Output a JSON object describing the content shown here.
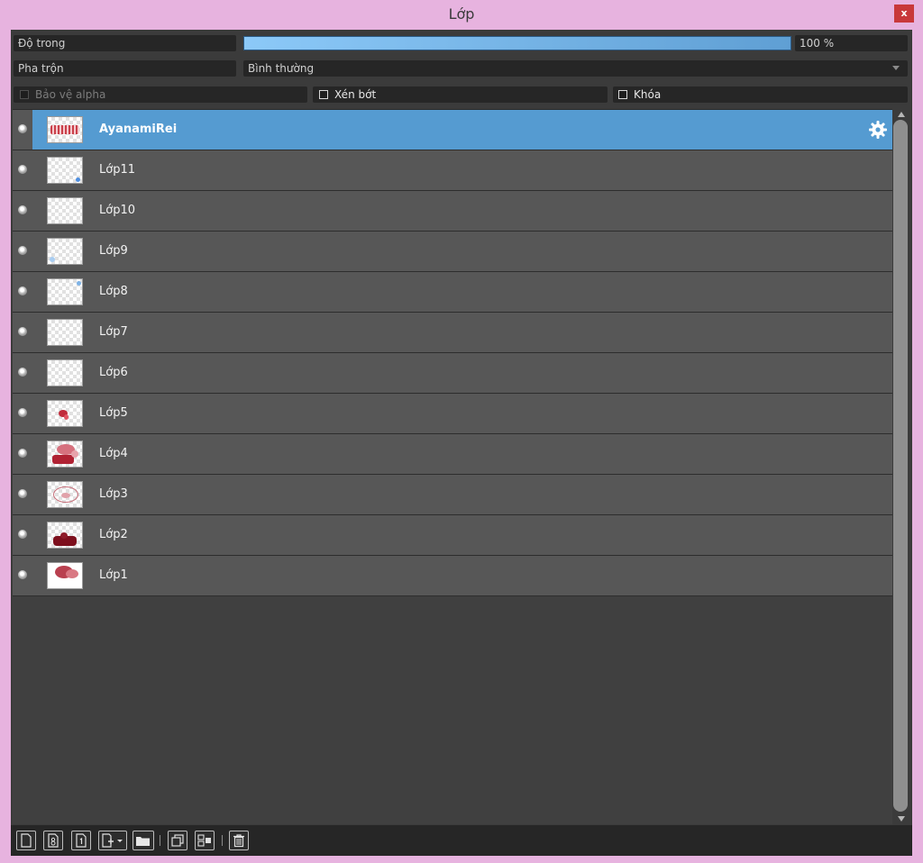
{
  "window": {
    "title": "Lớp",
    "close_label": "x"
  },
  "opacity": {
    "label": "Độ trong",
    "value_text": "100 %",
    "level": 1.0
  },
  "blend": {
    "label": "Pha trộn",
    "value": "Bình thường"
  },
  "options": {
    "protect_alpha": "Bảo vệ alpha",
    "clip": "Xén bớt",
    "lock": "Khóa"
  },
  "layers": [
    {
      "name": "AyanamiRei",
      "selected": true
    },
    {
      "name": "Lớp11"
    },
    {
      "name": "Lớp10"
    },
    {
      "name": "Lớp9"
    },
    {
      "name": "Lớp8"
    },
    {
      "name": "Lớp7"
    },
    {
      "name": "Lớp6"
    },
    {
      "name": "Lớp5"
    },
    {
      "name": "Lớp4"
    },
    {
      "name": "Lớp3"
    },
    {
      "name": "Lớp2"
    },
    {
      "name": "Lớp1"
    }
  ],
  "toolbar": {
    "icons": [
      "new-layer-icon",
      "new-8bit-layer-icon",
      "new-1bit-layer-icon",
      "add-layer-dropdown-icon",
      "folder-icon",
      "duplicate-icon",
      "merge-icon",
      "trash-icon"
    ]
  },
  "colors": {
    "accent": "#559bd1",
    "title_bar": "#e7b3df",
    "close": "#c8383a",
    "panel": "#3b3b3b",
    "row": "#575757"
  }
}
